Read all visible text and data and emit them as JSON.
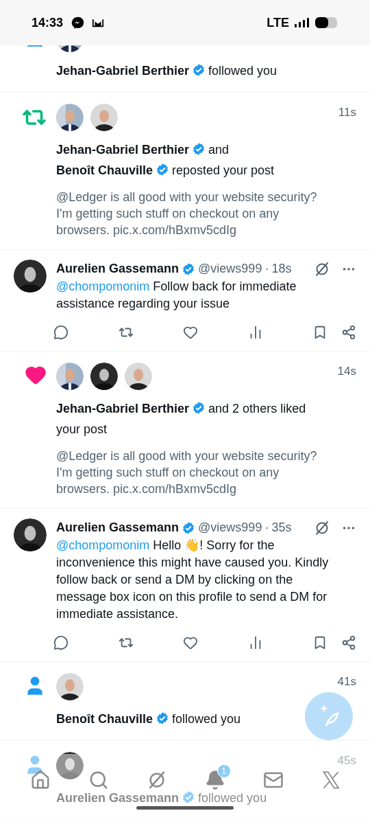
{
  "status_bar": {
    "time": "14:33",
    "network": "LTE"
  },
  "notifications": [
    {
      "kind": "follow",
      "avatars": [
        {
          "kind": "picture"
        }
      ],
      "segments": [
        {
          "kind": "name",
          "text": "Jehan-Gabriel Berthier",
          "verified": true
        },
        {
          "kind": "text",
          "text": "followed you"
        }
      ]
    },
    {
      "kind": "repost",
      "time": "11s",
      "avatars": [
        {
          "kind": "picture"
        },
        {
          "kind": "picture"
        }
      ],
      "segments": [
        {
          "kind": "name",
          "text": "Jehan-Gabriel Berthier",
          "verified": true
        },
        {
          "kind": "text",
          "text": "and"
        },
        {
          "kind": "break"
        },
        {
          "kind": "name",
          "text": "Benoît Chauville",
          "verified": true
        },
        {
          "kind": "text",
          "text": "reposted your post"
        }
      ],
      "preview": "@Ledger is all good with your website security? I'm getting such stuff on checkout on any browsers. pic.x.com/hBxmv5cdIg"
    },
    {
      "kind": "reply",
      "name": "Aurelien Gassemann",
      "verified": true,
      "handle": "@views999",
      "separator": "·",
      "time": "18s",
      "mention": "@chompomonim",
      "body": "Follow back for immediate assistance regarding your issue"
    },
    {
      "kind": "like",
      "time": "14s",
      "avatars": [
        {
          "kind": "picture"
        },
        {
          "kind": "picture"
        },
        {
          "kind": "picture"
        }
      ],
      "segments": [
        {
          "kind": "name",
          "text": "Jehan-Gabriel Berthier",
          "verified": true
        },
        {
          "kind": "text",
          "text": "and 2 others liked your post"
        }
      ],
      "preview": "@Ledger is all good with your website security? I'm getting such stuff on checkout on any browsers. pic.x.com/hBxmv5cdIg"
    },
    {
      "kind": "reply",
      "name": "Aurelien Gassemann",
      "verified": true,
      "handle": "@views999",
      "separator": "·",
      "time": "35s",
      "mention": "@chompomonim",
      "body": "Hello 👋! Sorry for the inconvenience this might have caused you. Kindly follow back or send a DM by clicking on the message box icon on this profile to send a DM for immediate assistance."
    },
    {
      "kind": "follow",
      "time": "41s",
      "avatars": [
        {
          "kind": "picture"
        }
      ],
      "segments": [
        {
          "kind": "name",
          "text": "Benoît Chauville",
          "verified": true
        },
        {
          "kind": "text",
          "text": "followed you"
        }
      ]
    },
    {
      "kind": "follow",
      "time": "45s",
      "avatars": [
        {
          "kind": "picture"
        }
      ],
      "segments": [
        {
          "kind": "name",
          "text": "Aurelien Gassemann",
          "verified": true
        },
        {
          "kind": "text",
          "text": "followed you"
        }
      ]
    }
  ],
  "nav": [
    {
      "kind": "home"
    },
    {
      "kind": "search"
    },
    {
      "kind": "grok"
    },
    {
      "kind": "notifications",
      "badge": "1"
    },
    {
      "kind": "messages"
    },
    {
      "kind": "x"
    }
  ]
}
